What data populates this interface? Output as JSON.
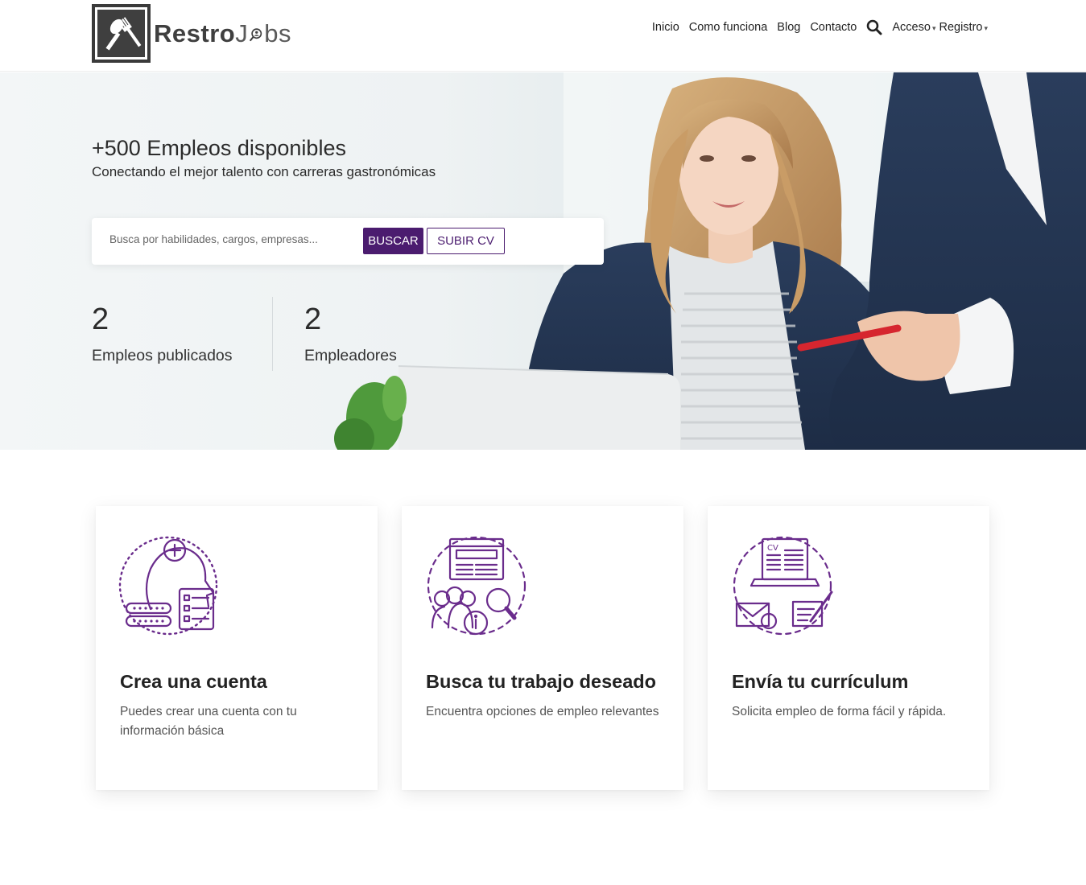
{
  "brand": {
    "name_part1": "Restro",
    "name_part2": "J",
    "name_part3": "bs",
    "accent": "#4b1c6f"
  },
  "nav": {
    "items": [
      "Inicio",
      "Como funciona",
      "Blog",
      "Contacto"
    ],
    "search_icon": "search-icon",
    "login": "Acceso",
    "register": "Registro"
  },
  "hero": {
    "title": "+500 Empleos disponibles",
    "subtitle": "Conectando el mejor talento con carreras gastronómicas",
    "search_placeholder": "Busca por habilidades, cargos, empresas...",
    "search_button": "BUSCAR",
    "cv_button": "SUBIR CV",
    "stats": [
      {
        "value": "2",
        "label": "Empleos publicados"
      },
      {
        "value": "2",
        "label": "Empleadores"
      }
    ]
  },
  "cards": [
    {
      "icon": "create-account-icon",
      "title": "Crea una cuenta",
      "description": "Puedes crear una cuenta con tu información básica"
    },
    {
      "icon": "job-search-icon",
      "title": "Busca tu trabajo deseado",
      "description": "Encuentra opciones de empleo relevantes"
    },
    {
      "icon": "send-cv-icon",
      "title": "Envía tu currículum",
      "description": "Solicita empleo de forma fácil y rápida."
    }
  ]
}
